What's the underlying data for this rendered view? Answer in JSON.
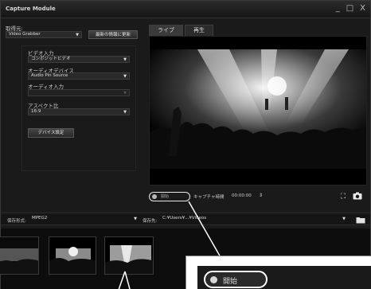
{
  "window": {
    "title": "Capture Module",
    "minimize": "_",
    "restore": "□",
    "close": "X"
  },
  "source": {
    "label": "取得元:",
    "value": "Video Grabber",
    "refresh_button": "最新の情報に更新"
  },
  "video_input": {
    "label": "ビデオ入力",
    "value": "コンポジットビデオ"
  },
  "audio_device": {
    "label": "オーディオデバイス",
    "value": "Audio Pin Source"
  },
  "audio_input": {
    "label": "オーディオ入力",
    "value": ""
  },
  "aspect": {
    "label": "アスペクト比",
    "value": "16:9"
  },
  "device_settings_button": "デバイス設定",
  "tabs": [
    {
      "label": "ライブ"
    },
    {
      "label": "再生"
    }
  ],
  "capture": {
    "button_label": "開始",
    "time_label": "キャプチャ時間",
    "time_value": "00:00:00",
    "spin": "⇕"
  },
  "save": {
    "format_label": "保存形式:",
    "format_value": "MPEG2",
    "dest_label": "保存先:",
    "dest_value": "C:¥Users¥...¥Videos"
  },
  "callout": {
    "button_label": "開始"
  },
  "icons": {
    "fullscreen": "fullscreen-icon",
    "snapshot": "camera-icon",
    "folder": "folder-icon"
  }
}
